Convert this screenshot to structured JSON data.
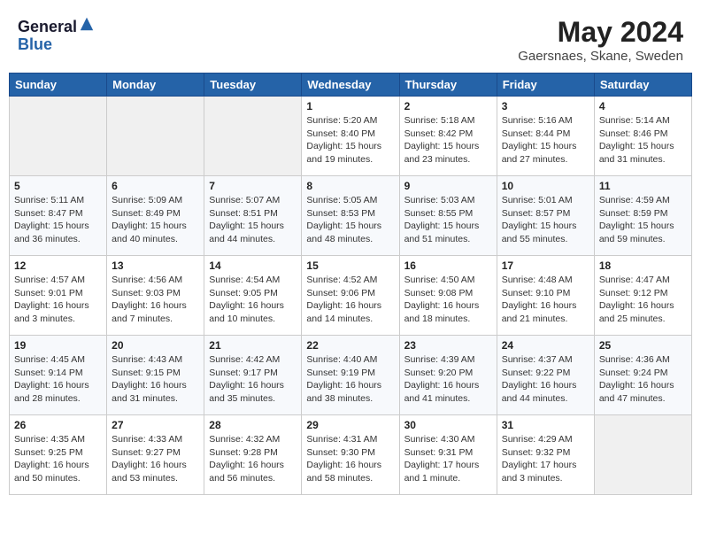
{
  "header": {
    "logo_general": "General",
    "logo_blue": "Blue",
    "month_year": "May 2024",
    "location": "Gaersnaes, Skane, Sweden"
  },
  "days_of_week": [
    "Sunday",
    "Monday",
    "Tuesday",
    "Wednesday",
    "Thursday",
    "Friday",
    "Saturday"
  ],
  "weeks": [
    [
      {
        "day": "",
        "info": ""
      },
      {
        "day": "",
        "info": ""
      },
      {
        "day": "",
        "info": ""
      },
      {
        "day": "1",
        "info": "Sunrise: 5:20 AM\nSunset: 8:40 PM\nDaylight: 15 hours\nand 19 minutes."
      },
      {
        "day": "2",
        "info": "Sunrise: 5:18 AM\nSunset: 8:42 PM\nDaylight: 15 hours\nand 23 minutes."
      },
      {
        "day": "3",
        "info": "Sunrise: 5:16 AM\nSunset: 8:44 PM\nDaylight: 15 hours\nand 27 minutes."
      },
      {
        "day": "4",
        "info": "Sunrise: 5:14 AM\nSunset: 8:46 PM\nDaylight: 15 hours\nand 31 minutes."
      }
    ],
    [
      {
        "day": "5",
        "info": "Sunrise: 5:11 AM\nSunset: 8:47 PM\nDaylight: 15 hours\nand 36 minutes."
      },
      {
        "day": "6",
        "info": "Sunrise: 5:09 AM\nSunset: 8:49 PM\nDaylight: 15 hours\nand 40 minutes."
      },
      {
        "day": "7",
        "info": "Sunrise: 5:07 AM\nSunset: 8:51 PM\nDaylight: 15 hours\nand 44 minutes."
      },
      {
        "day": "8",
        "info": "Sunrise: 5:05 AM\nSunset: 8:53 PM\nDaylight: 15 hours\nand 48 minutes."
      },
      {
        "day": "9",
        "info": "Sunrise: 5:03 AM\nSunset: 8:55 PM\nDaylight: 15 hours\nand 51 minutes."
      },
      {
        "day": "10",
        "info": "Sunrise: 5:01 AM\nSunset: 8:57 PM\nDaylight: 15 hours\nand 55 minutes."
      },
      {
        "day": "11",
        "info": "Sunrise: 4:59 AM\nSunset: 8:59 PM\nDaylight: 15 hours\nand 59 minutes."
      }
    ],
    [
      {
        "day": "12",
        "info": "Sunrise: 4:57 AM\nSunset: 9:01 PM\nDaylight: 16 hours\nand 3 minutes."
      },
      {
        "day": "13",
        "info": "Sunrise: 4:56 AM\nSunset: 9:03 PM\nDaylight: 16 hours\nand 7 minutes."
      },
      {
        "day": "14",
        "info": "Sunrise: 4:54 AM\nSunset: 9:05 PM\nDaylight: 16 hours\nand 10 minutes."
      },
      {
        "day": "15",
        "info": "Sunrise: 4:52 AM\nSunset: 9:06 PM\nDaylight: 16 hours\nand 14 minutes."
      },
      {
        "day": "16",
        "info": "Sunrise: 4:50 AM\nSunset: 9:08 PM\nDaylight: 16 hours\nand 18 minutes."
      },
      {
        "day": "17",
        "info": "Sunrise: 4:48 AM\nSunset: 9:10 PM\nDaylight: 16 hours\nand 21 minutes."
      },
      {
        "day": "18",
        "info": "Sunrise: 4:47 AM\nSunset: 9:12 PM\nDaylight: 16 hours\nand 25 minutes."
      }
    ],
    [
      {
        "day": "19",
        "info": "Sunrise: 4:45 AM\nSunset: 9:14 PM\nDaylight: 16 hours\nand 28 minutes."
      },
      {
        "day": "20",
        "info": "Sunrise: 4:43 AM\nSunset: 9:15 PM\nDaylight: 16 hours\nand 31 minutes."
      },
      {
        "day": "21",
        "info": "Sunrise: 4:42 AM\nSunset: 9:17 PM\nDaylight: 16 hours\nand 35 minutes."
      },
      {
        "day": "22",
        "info": "Sunrise: 4:40 AM\nSunset: 9:19 PM\nDaylight: 16 hours\nand 38 minutes."
      },
      {
        "day": "23",
        "info": "Sunrise: 4:39 AM\nSunset: 9:20 PM\nDaylight: 16 hours\nand 41 minutes."
      },
      {
        "day": "24",
        "info": "Sunrise: 4:37 AM\nSunset: 9:22 PM\nDaylight: 16 hours\nand 44 minutes."
      },
      {
        "day": "25",
        "info": "Sunrise: 4:36 AM\nSunset: 9:24 PM\nDaylight: 16 hours\nand 47 minutes."
      }
    ],
    [
      {
        "day": "26",
        "info": "Sunrise: 4:35 AM\nSunset: 9:25 PM\nDaylight: 16 hours\nand 50 minutes."
      },
      {
        "day": "27",
        "info": "Sunrise: 4:33 AM\nSunset: 9:27 PM\nDaylight: 16 hours\nand 53 minutes."
      },
      {
        "day": "28",
        "info": "Sunrise: 4:32 AM\nSunset: 9:28 PM\nDaylight: 16 hours\nand 56 minutes."
      },
      {
        "day": "29",
        "info": "Sunrise: 4:31 AM\nSunset: 9:30 PM\nDaylight: 16 hours\nand 58 minutes."
      },
      {
        "day": "30",
        "info": "Sunrise: 4:30 AM\nSunset: 9:31 PM\nDaylight: 17 hours\nand 1 minute."
      },
      {
        "day": "31",
        "info": "Sunrise: 4:29 AM\nSunset: 9:32 PM\nDaylight: 17 hours\nand 3 minutes."
      },
      {
        "day": "",
        "info": ""
      }
    ]
  ]
}
